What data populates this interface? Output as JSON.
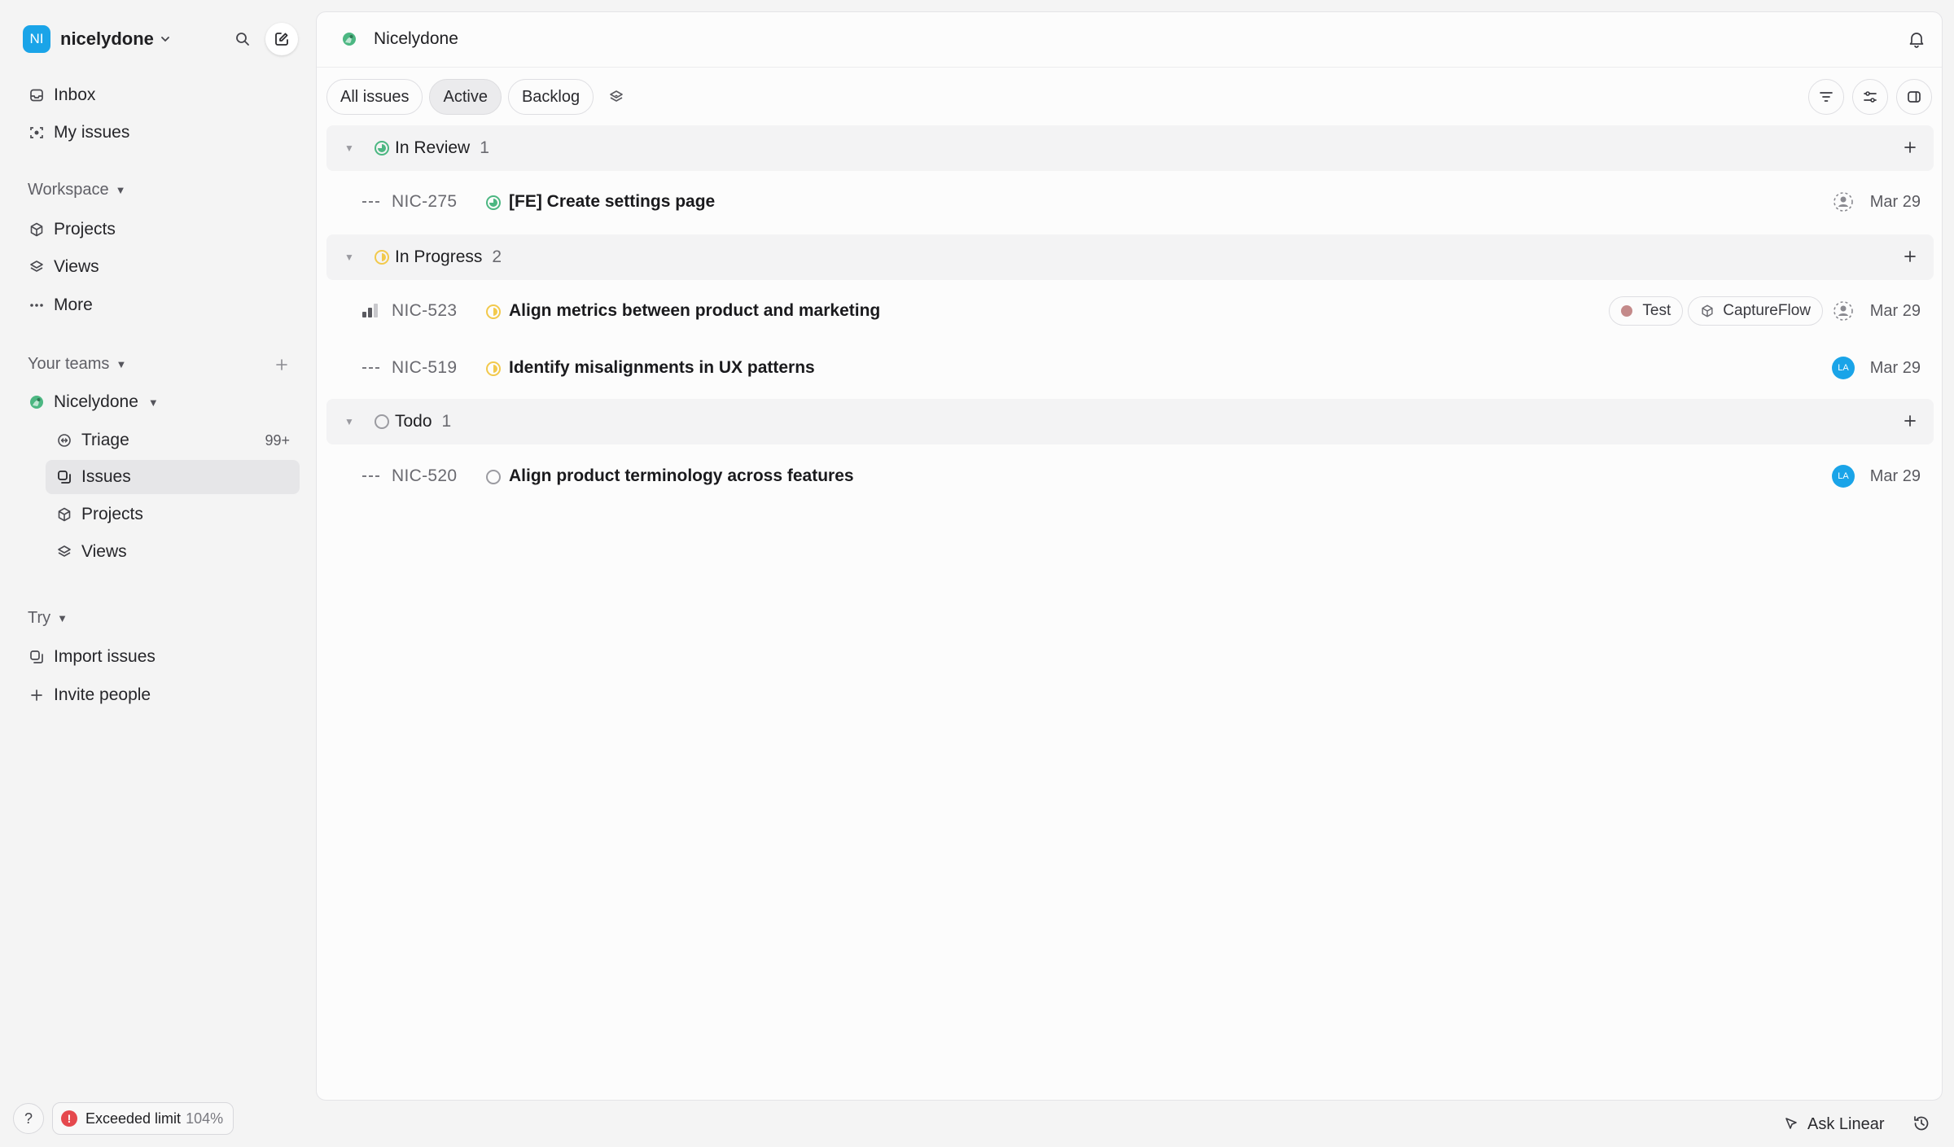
{
  "workspace": {
    "initials": "NI",
    "name": "nicelydone"
  },
  "sidebar": {
    "inbox": "Inbox",
    "my_issues": "My issues",
    "workspace_label": "Workspace",
    "workspace_items": [
      "Projects",
      "Views",
      "More"
    ],
    "teams_label": "Your teams",
    "team_name": "Nicelydone",
    "team_items": [
      {
        "label": "Triage",
        "badge": "99+"
      },
      {
        "label": "Issues"
      },
      {
        "label": "Projects"
      },
      {
        "label": "Views"
      }
    ],
    "try_label": "Try",
    "try_items": [
      "Import issues",
      "Invite people"
    ]
  },
  "footer": {
    "help": "?",
    "limit_label": "Exceeded limit",
    "limit_pct": "104%",
    "ask": "Ask Linear"
  },
  "main": {
    "title": "Nicelydone",
    "tabs": [
      "All issues",
      "Active",
      "Backlog"
    ],
    "active_tab": "Active"
  },
  "groups": [
    {
      "name": "In Review",
      "count": "1",
      "status_color": "#4cb782",
      "issues": [
        {
          "id": "NIC-275",
          "title": "[FE] Create settings page",
          "priority": "none",
          "date": "Mar 29",
          "assignee": "none",
          "labels": []
        }
      ]
    },
    {
      "name": "In Progress",
      "count": "2",
      "status_color": "#f2c94c",
      "issues": [
        {
          "id": "NIC-523",
          "title": "Align metrics between product and marketing",
          "priority": "medium",
          "date": "Mar 29",
          "assignee": "none",
          "labels": [
            "Test",
            "CaptureFlow"
          ]
        },
        {
          "id": "NIC-519",
          "title": "Identify misalignments in UX patterns",
          "priority": "none",
          "date": "Mar 29",
          "assignee": "LA",
          "labels": []
        }
      ]
    },
    {
      "name": "Todo",
      "count": "1",
      "status_color": "#9b9ba1",
      "issues": [
        {
          "id": "NIC-520",
          "title": "Align product terminology across features",
          "priority": "none",
          "date": "Mar 29",
          "assignee": "LA",
          "labels": []
        }
      ]
    }
  ],
  "colors": {
    "accent": "#1aa4e8",
    "in_review": "#4cb782",
    "in_progress": "#f2c94c",
    "error": "#e5484d"
  }
}
